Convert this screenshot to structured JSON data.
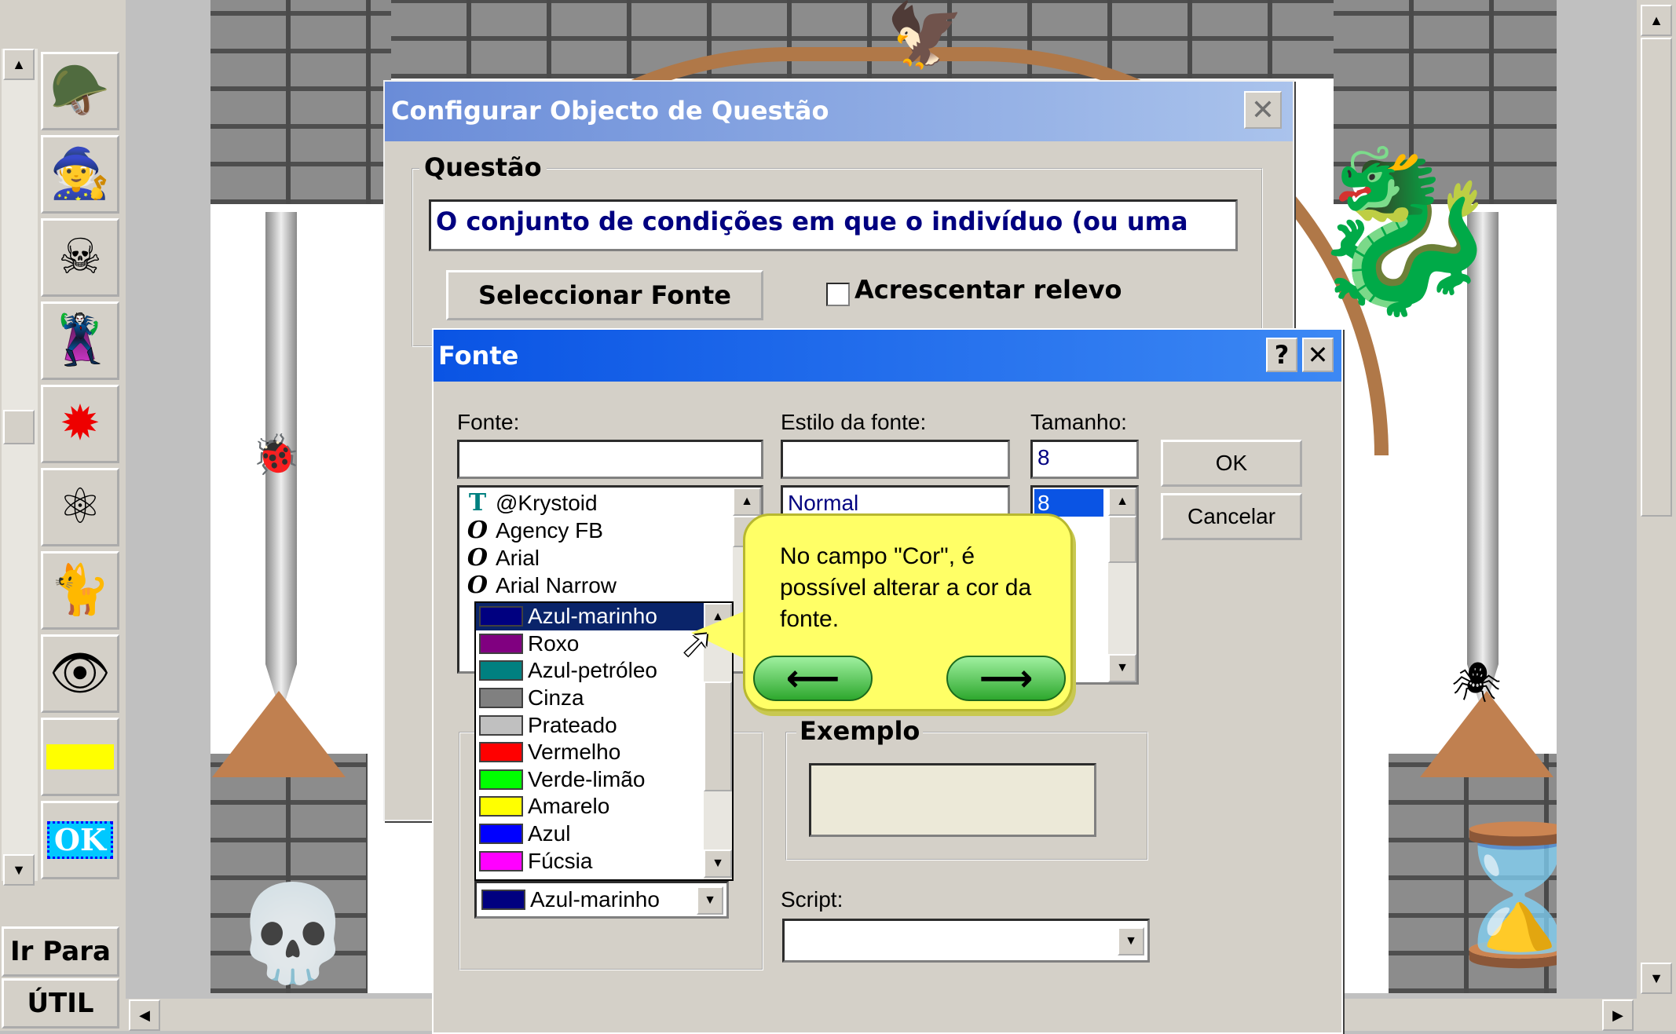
{
  "toolbar": {
    "icons": [
      "knight-icon",
      "witch-icon",
      "skull-crossbones-icon",
      "villain-icon",
      "explosion-icon",
      "orbs-icon",
      "black-cat-icon",
      "eye-icon",
      "yellow-rectangle-icon",
      "ok-icon"
    ],
    "ok_label": "OK"
  },
  "nav": {
    "ir_para": "Ir Para",
    "util": "ÚTIL"
  },
  "config_dialog": {
    "title": "Configurar Objecto de Questão",
    "questao_legend": "Questão",
    "question_text": "O conjunto de condições em que o indivíduo (ou uma",
    "select_font_button": "Seleccionar Fonte",
    "relevo_label": "Acrescentar relevo"
  },
  "font_dialog": {
    "title": "Fonte",
    "help_button": "?",
    "close_button": "✕",
    "fonte_label": "Fonte:",
    "estilo_label": "Estilo da fonte:",
    "tamanho_label": "Tamanho:",
    "tamanho_value": "8",
    "font_list": [
      {
        "icon": "truetype-icon",
        "glyph": "T",
        "name": "@Krystoid"
      },
      {
        "icon": "opentype-icon",
        "glyph": "O",
        "name": "Agency FB"
      },
      {
        "icon": "opentype-icon",
        "glyph": "O",
        "name": "Arial"
      },
      {
        "icon": "opentype-icon",
        "glyph": "O",
        "name": "Arial Narrow"
      }
    ],
    "style_selected": "Normal",
    "size_selected": "8",
    "ok_button": "OK",
    "cancel_button": "Cancelar",
    "exemplo_legend": "Exemplo",
    "script_label": "Script:",
    "color_selected": "Azul-marinho",
    "color_options": [
      {
        "name": "Azul-marinho",
        "color": "#000080",
        "selected": true
      },
      {
        "name": "Roxo",
        "color": "#800080"
      },
      {
        "name": "Azul-petróleo",
        "color": "#008080"
      },
      {
        "name": "Cinza",
        "color": "#808080"
      },
      {
        "name": "Prateado",
        "color": "#c0c0c0"
      },
      {
        "name": "Vermelho",
        "color": "#ff0000"
      },
      {
        "name": "Verde-limão",
        "color": "#00ff00"
      },
      {
        "name": "Amarelo",
        "color": "#ffff00"
      },
      {
        "name": "Azul",
        "color": "#0000ff"
      },
      {
        "name": "Fúcsia",
        "color": "#ff00ff"
      }
    ]
  },
  "tooltip": {
    "text": "No campo \"Cor\", é possível alterar a cor da fonte.",
    "prev": "⟵",
    "next": "⟶"
  },
  "colors": {
    "title_blue": "#0a54e4",
    "config_title": "#6a8cd8",
    "tooltip_bg": "#ffff66",
    "selection": "#0a246a"
  }
}
